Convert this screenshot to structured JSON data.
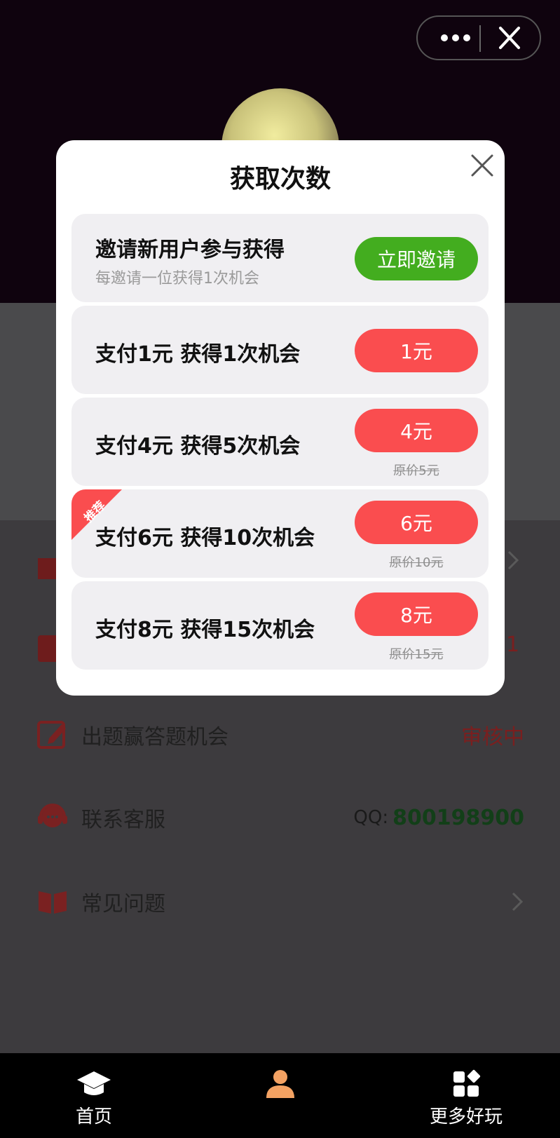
{
  "modal": {
    "title": "获取次数",
    "options": [
      {
        "title": "邀请新用户参与获得",
        "subtitle": "每邀请一位获得1次机会",
        "button": "立即邀请"
      },
      {
        "title": "支付1元 获得1次机会",
        "button": "1元"
      },
      {
        "title": "支付4元 获得5次机会",
        "button": "4元",
        "original_price": "原价5元"
      },
      {
        "title": "支付6元 获得10次机会",
        "button": "6元",
        "original_price": "原价10元",
        "badge": "推荐"
      },
      {
        "title": "支付8元 获得15次机会",
        "button": "8元",
        "original_price": "原价15元"
      }
    ]
  },
  "menu": {
    "items": [
      {
        "label": "出题赢答题机会",
        "value": "审核中"
      },
      {
        "label": "联系客服",
        "value_prefix": "QQ:",
        "value": "800198900"
      },
      {
        "label": "常见问题"
      }
    ]
  },
  "tabbar": {
    "items": [
      {
        "label": "首页",
        "icon": "graduation-cap-icon"
      },
      {
        "label": "",
        "icon": "user-icon"
      },
      {
        "label": "更多好玩",
        "icon": "apps-grid-icon"
      }
    ]
  },
  "colors": {
    "accent_green": "#43ad1f",
    "accent_red": "#fa4d4f",
    "status_red": "#7a1f1f",
    "qq_green": "#123f18"
  }
}
